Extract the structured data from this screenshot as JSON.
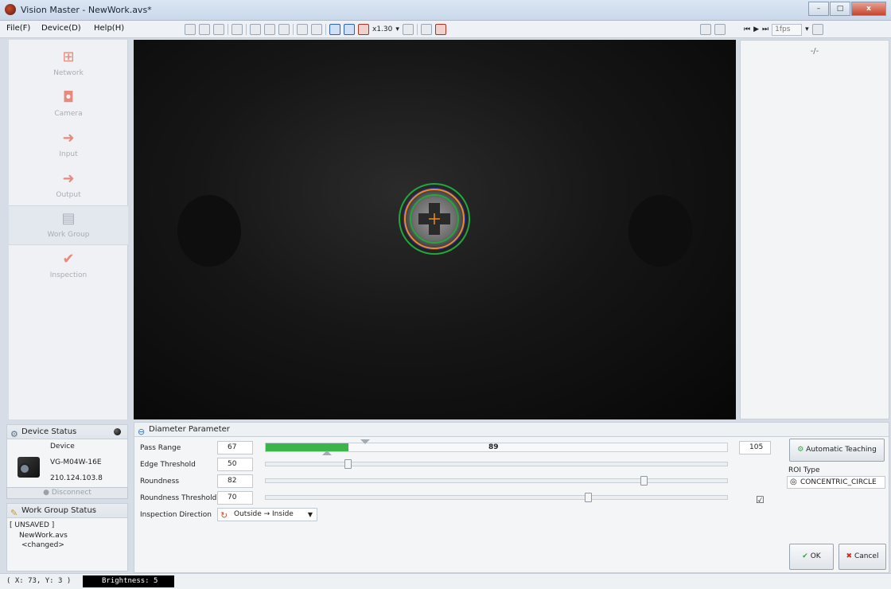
{
  "window": {
    "title": "Vision Master - NewWork.avs*"
  },
  "menu": {
    "file": "File(F)",
    "device": "Device(D)",
    "help": "Help(H)"
  },
  "toolbar": {
    "zoom": "x1.30",
    "fps": "1fps"
  },
  "nav": [
    {
      "label": "Network",
      "icon": "network-icon"
    },
    {
      "label": "Camera",
      "icon": "camera-icon"
    },
    {
      "label": "Input",
      "icon": "input-icon"
    },
    {
      "label": "Output",
      "icon": "output-icon"
    },
    {
      "label": "Work Group",
      "icon": "workgroup-icon"
    },
    {
      "label": "Inspection",
      "icon": "inspection-icon"
    }
  ],
  "right_panel": {
    "header": "-/-"
  },
  "device_status": {
    "title": "Device Status",
    "device_label": "Device",
    "model": "VG-M04W-16E",
    "ip": "210.124.103.8",
    "disconnect": "Disconnect"
  },
  "workgroup_status": {
    "title": "Work Group Status",
    "state": "[ UNSAVED ]",
    "file": "NewWork.avs",
    "changed": "<changed>"
  },
  "params": {
    "title": "Diameter Parameter",
    "pass_range": {
      "label": "Pass Range",
      "min": "67",
      "current": "89",
      "max": "105",
      "fill_fraction": 0.18
    },
    "edge_threshold": {
      "label": "Edge Threshold",
      "value": "50",
      "position": 0.18
    },
    "roundness": {
      "label": "Roundness",
      "value": "82",
      "position": 0.82
    },
    "roundness_threshold": {
      "label": "Roundness Threshold",
      "value": "70",
      "position": 0.7,
      "checked": true
    },
    "inspection_direction": {
      "label": "Inspection Direction",
      "value": "Outside → Inside"
    },
    "auto_teaching": "Automatic Teaching",
    "roi_type_label": "ROI Type",
    "roi_type_value": "CONCENTRIC_CIRCLE",
    "ok": "OK",
    "cancel": "Cancel"
  },
  "status": {
    "coords": "( X: 73, Y:  3 )",
    "brightness": "Brightness:  5"
  }
}
